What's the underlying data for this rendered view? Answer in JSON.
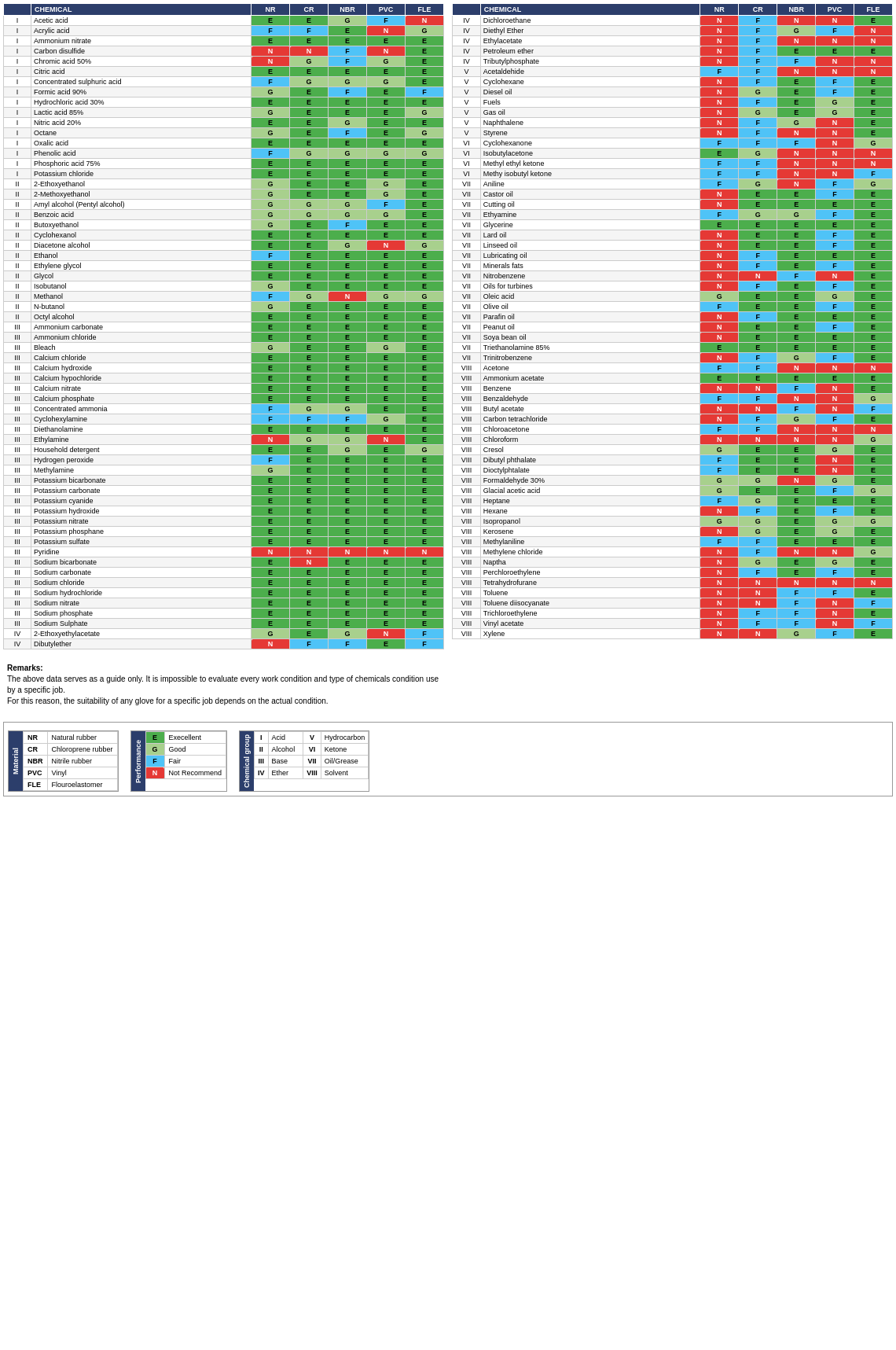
{
  "tables": {
    "left": {
      "headers": [
        "",
        "CHEMICAL",
        "NR",
        "CR",
        "NBR",
        "PVC",
        "FLE"
      ],
      "rows": [
        [
          "I",
          "Acetic acid",
          "E",
          "E",
          "G",
          "F",
          "N"
        ],
        [
          "I",
          "Acrylic acid",
          "F",
          "F",
          "E",
          "N",
          "G"
        ],
        [
          "I",
          "Ammonium nitrate",
          "E",
          "E",
          "E",
          "E",
          "E"
        ],
        [
          "I",
          "Carbon disulfide",
          "N",
          "N",
          "F",
          "N",
          "E"
        ],
        [
          "I",
          "Chromic acid 50%",
          "N",
          "G",
          "F",
          "G",
          "E"
        ],
        [
          "I",
          "Citric acid",
          "E",
          "E",
          "E",
          "E",
          "E"
        ],
        [
          "I",
          "Concentrated sulphuric acid",
          "F",
          "G",
          "G",
          "G",
          "E"
        ],
        [
          "I",
          "Formic acid 90%",
          "G",
          "E",
          "F",
          "E",
          "F"
        ],
        [
          "I",
          "Hydrochloric acid 30%",
          "E",
          "E",
          "E",
          "E",
          "E"
        ],
        [
          "I",
          "Lactic acid 85%",
          "G",
          "E",
          "E",
          "E",
          "G"
        ],
        [
          "I",
          "Nitric acid 20%",
          "E",
          "E",
          "G",
          "E",
          "E"
        ],
        [
          "I",
          "Octane",
          "G",
          "E",
          "F",
          "E",
          "G"
        ],
        [
          "I",
          "Oxalic acid",
          "E",
          "E",
          "E",
          "E",
          "E"
        ],
        [
          "I",
          "Phenolic acid",
          "F",
          "G",
          "G",
          "G",
          "G"
        ],
        [
          "I",
          "Phosphoric acid 75%",
          "E",
          "E",
          "E",
          "E",
          "E"
        ],
        [
          "I",
          "Potassium chloride",
          "E",
          "E",
          "E",
          "E",
          "E"
        ],
        [
          "II",
          "2-Ethoxyethanol",
          "G",
          "E",
          "E",
          "G",
          "E"
        ],
        [
          "II",
          "2-Methoxyethanol",
          "G",
          "E",
          "E",
          "G",
          "E"
        ],
        [
          "II",
          "Amyl alcohol (Pentyl alcohol)",
          "G",
          "G",
          "G",
          "F",
          "E"
        ],
        [
          "II",
          "Benzoic acid",
          "G",
          "G",
          "G",
          "G",
          "E"
        ],
        [
          "II",
          "Butoxyethanol",
          "G",
          "E",
          "F",
          "E",
          "E"
        ],
        [
          "II",
          "Cyclohexanol",
          "E",
          "E",
          "E",
          "E",
          "E"
        ],
        [
          "II",
          "Diacetone alcohol",
          "E",
          "E",
          "G",
          "N",
          "G"
        ],
        [
          "II",
          "Ethanol",
          "F",
          "E",
          "E",
          "E",
          "E"
        ],
        [
          "II",
          "Ethylene glycol",
          "E",
          "E",
          "E",
          "E",
          "E"
        ],
        [
          "II",
          "Glycol",
          "E",
          "E",
          "E",
          "E",
          "E"
        ],
        [
          "II",
          "Isobutanol",
          "G",
          "E",
          "E",
          "E",
          "E"
        ],
        [
          "II",
          "Methanol",
          "F",
          "G",
          "N",
          "G",
          "G"
        ],
        [
          "II",
          "N-butanol",
          "G",
          "E",
          "E",
          "E",
          "E"
        ],
        [
          "II",
          "Octyl alcohol",
          "E",
          "E",
          "E",
          "E",
          "E"
        ],
        [
          "III",
          "Ammonium carbonate",
          "E",
          "E",
          "E",
          "E",
          "E"
        ],
        [
          "III",
          "Ammonium chloride",
          "E",
          "E",
          "E",
          "E",
          "E"
        ],
        [
          "III",
          "Bleach",
          "G",
          "E",
          "E",
          "G",
          "E"
        ],
        [
          "III",
          "Calcium chloride",
          "E",
          "E",
          "E",
          "E",
          "E"
        ],
        [
          "III",
          "Calcium hydroxide",
          "E",
          "E",
          "E",
          "E",
          "E"
        ],
        [
          "III",
          "Calcium hypochloride",
          "E",
          "E",
          "E",
          "E",
          "E"
        ],
        [
          "III",
          "Calcium nitrate",
          "E",
          "E",
          "E",
          "E",
          "E"
        ],
        [
          "III",
          "Calcium phosphate",
          "E",
          "E",
          "E",
          "E",
          "E"
        ],
        [
          "III",
          "Concentrated ammonia",
          "F",
          "G",
          "G",
          "E",
          "E"
        ],
        [
          "III",
          "Cyclohexylamine",
          "F",
          "F",
          "F",
          "G",
          "E"
        ],
        [
          "III",
          "Diethanolamine",
          "E",
          "E",
          "E",
          "E",
          "E"
        ],
        [
          "III",
          "Ethylamine",
          "N",
          "G",
          "G",
          "N",
          "E"
        ],
        [
          "III",
          "Household detergent",
          "E",
          "E",
          "G",
          "E",
          "G"
        ],
        [
          "III",
          "Hydrogen peroxide",
          "F",
          "E",
          "E",
          "E",
          "E"
        ],
        [
          "III",
          "Methylamine",
          "G",
          "E",
          "E",
          "E",
          "E"
        ],
        [
          "III",
          "Potassium bicarbonate",
          "E",
          "E",
          "E",
          "E",
          "E"
        ],
        [
          "III",
          "Potassium carbonate",
          "E",
          "E",
          "E",
          "E",
          "E"
        ],
        [
          "III",
          "Potassium cyanide",
          "E",
          "E",
          "E",
          "E",
          "E"
        ],
        [
          "III",
          "Potassium hydroxide",
          "E",
          "E",
          "E",
          "E",
          "E"
        ],
        [
          "III",
          "Potassium nitrate",
          "E",
          "E",
          "E",
          "E",
          "E"
        ],
        [
          "III",
          "Potassium phosphane",
          "E",
          "E",
          "E",
          "E",
          "E"
        ],
        [
          "III",
          "Potassium sulfate",
          "E",
          "E",
          "E",
          "E",
          "E"
        ],
        [
          "III",
          "Pyridine",
          "N",
          "N",
          "N",
          "N",
          "N"
        ],
        [
          "III",
          "Sodium bicarbonate",
          "E",
          "N",
          "E",
          "E",
          "E"
        ],
        [
          "III",
          "Sodium carbonate",
          "E",
          "E",
          "E",
          "E",
          "E"
        ],
        [
          "III",
          "Sodium chloride",
          "E",
          "E",
          "E",
          "E",
          "E"
        ],
        [
          "III",
          "Sodium hydrochloride",
          "E",
          "E",
          "E",
          "E",
          "E"
        ],
        [
          "III",
          "Sodium nitrate",
          "E",
          "E",
          "E",
          "E",
          "E"
        ],
        [
          "III",
          "Sodium phosphate",
          "E",
          "E",
          "E",
          "E",
          "E"
        ],
        [
          "III",
          "Sodium Sulphate",
          "E",
          "E",
          "E",
          "E",
          "E"
        ],
        [
          "IV",
          "2-Ethoxyethylacetate",
          "G",
          "E",
          "G",
          "N",
          "F"
        ],
        [
          "IV",
          "Dibutylether",
          "N",
          "F",
          "F",
          "E",
          "F"
        ]
      ]
    },
    "right": {
      "headers": [
        "",
        "CHEMICAL",
        "NR",
        "CR",
        "NBR",
        "PVC",
        "FLE"
      ],
      "rows": [
        [
          "IV",
          "Dichloroethane",
          "N",
          "F",
          "N",
          "N",
          "E"
        ],
        [
          "IV",
          "Diethyl Ether",
          "N",
          "F",
          "G",
          "F",
          "N"
        ],
        [
          "IV",
          "Ethylacetate",
          "N",
          "F",
          "N",
          "N",
          "N"
        ],
        [
          "IV",
          "Petroleum ether",
          "N",
          "F",
          "E",
          "E",
          "E"
        ],
        [
          "IV",
          "Tributylphosphate",
          "N",
          "F",
          "F",
          "N",
          "N"
        ],
        [
          "V",
          "Acetaldehide",
          "F",
          "F",
          "N",
          "N",
          "N"
        ],
        [
          "V",
          "Cyclohexane",
          "N",
          "F",
          "E",
          "F",
          "E"
        ],
        [
          "V",
          "Diesel oil",
          "N",
          "G",
          "E",
          "F",
          "E"
        ],
        [
          "V",
          "Fuels",
          "N",
          "F",
          "E",
          "G",
          "E"
        ],
        [
          "V",
          "Gas oil",
          "N",
          "G",
          "E",
          "G",
          "E"
        ],
        [
          "V",
          "Naphthalene",
          "N",
          "F",
          "G",
          "N",
          "E"
        ],
        [
          "V",
          "Styrene",
          "N",
          "F",
          "N",
          "N",
          "E"
        ],
        [
          "VI",
          "Cyclohexanone",
          "F",
          "F",
          "F",
          "N",
          "G"
        ],
        [
          "VI",
          "Isobutylacetone",
          "E",
          "G",
          "N",
          "N",
          "N"
        ],
        [
          "VI",
          "Methyl ethyl ketone",
          "F",
          "F",
          "N",
          "N",
          "N"
        ],
        [
          "VI",
          "Methy isobutyl ketone",
          "F",
          "F",
          "N",
          "N",
          "F"
        ],
        [
          "VII",
          "Aniline",
          "F",
          "G",
          "N",
          "F",
          "G"
        ],
        [
          "VII",
          "Castor oil",
          "N",
          "E",
          "E",
          "F",
          "E"
        ],
        [
          "VII",
          "Cutting oil",
          "N",
          "E",
          "E",
          "E",
          "E"
        ],
        [
          "VII",
          "Ethyamine",
          "F",
          "G",
          "G",
          "F",
          "E"
        ],
        [
          "VII",
          "Glycerine",
          "E",
          "E",
          "E",
          "E",
          "E"
        ],
        [
          "VII",
          "Lard oil",
          "N",
          "E",
          "E",
          "F",
          "E"
        ],
        [
          "VII",
          "Linseed oil",
          "N",
          "E",
          "E",
          "F",
          "E"
        ],
        [
          "VII",
          "Lubricating oil",
          "N",
          "F",
          "E",
          "E",
          "E"
        ],
        [
          "VII",
          "Minerals fats",
          "N",
          "F",
          "E",
          "F",
          "E"
        ],
        [
          "VII",
          "Nitrobenzene",
          "N",
          "N",
          "F",
          "N",
          "E"
        ],
        [
          "VII",
          "Oils for turbines",
          "N",
          "F",
          "E",
          "F",
          "E"
        ],
        [
          "VII",
          "Oleic acid",
          "G",
          "E",
          "E",
          "G",
          "E"
        ],
        [
          "VII",
          "Olive oil",
          "F",
          "E",
          "E",
          "F",
          "E"
        ],
        [
          "VII",
          "Parafin oil",
          "N",
          "F",
          "E",
          "E",
          "E"
        ],
        [
          "VII",
          "Peanut oil",
          "N",
          "E",
          "E",
          "F",
          "E"
        ],
        [
          "VII",
          "Soya bean oil",
          "N",
          "E",
          "E",
          "E",
          "E"
        ],
        [
          "VII",
          "Triethanolamine 85%",
          "E",
          "E",
          "E",
          "E",
          "E"
        ],
        [
          "VII",
          "Trinitrobenzene",
          "N",
          "F",
          "G",
          "F",
          "E"
        ],
        [
          "VIII",
          "Acetone",
          "F",
          "F",
          "N",
          "N",
          "N"
        ],
        [
          "VIII",
          "Ammonium acetate",
          "E",
          "E",
          "E",
          "E",
          "E"
        ],
        [
          "VIII",
          "Benzene",
          "N",
          "N",
          "F",
          "N",
          "E"
        ],
        [
          "VIII",
          "Benzaldehyde",
          "F",
          "F",
          "N",
          "N",
          "G"
        ],
        [
          "VIII",
          "Butyl acetate",
          "N",
          "N",
          "F",
          "N",
          "F"
        ],
        [
          "VIII",
          "Carbon tetrachloride",
          "N",
          "F",
          "G",
          "F",
          "E"
        ],
        [
          "VIII",
          "Chloroacetone",
          "F",
          "F",
          "N",
          "N",
          "N"
        ],
        [
          "VIII",
          "Chloroform",
          "N",
          "N",
          "N",
          "N",
          "G"
        ],
        [
          "VIII",
          "Cresol",
          "G",
          "E",
          "E",
          "G",
          "E"
        ],
        [
          "VIII",
          "Dibutyl phthalate",
          "F",
          "E",
          "E",
          "N",
          "E"
        ],
        [
          "VIII",
          "Dioctylphtalate",
          "F",
          "E",
          "E",
          "N",
          "E"
        ],
        [
          "VIII",
          "Formaldehyde 30%",
          "G",
          "G",
          "N",
          "G",
          "E"
        ],
        [
          "VIII",
          "Glacial acetic acid",
          "G",
          "E",
          "E",
          "F",
          "G"
        ],
        [
          "VIII",
          "Heptane",
          "F",
          "G",
          "E",
          "E",
          "E"
        ],
        [
          "VIII",
          "Hexane",
          "N",
          "F",
          "E",
          "F",
          "E"
        ],
        [
          "VIII",
          "Isopropanol",
          "G",
          "G",
          "E",
          "G",
          "G"
        ],
        [
          "VIII",
          "Kerosene",
          "N",
          "G",
          "E",
          "G",
          "E"
        ],
        [
          "VIII",
          "Methylaniline",
          "F",
          "F",
          "E",
          "E",
          "E"
        ],
        [
          "VIII",
          "Methylene chloride",
          "N",
          "F",
          "N",
          "N",
          "G"
        ],
        [
          "VIII",
          "Naptha",
          "N",
          "G",
          "E",
          "G",
          "E"
        ],
        [
          "VIII",
          "Perchloroethylene",
          "N",
          "F",
          "E",
          "F",
          "E"
        ],
        [
          "VIII",
          "Tetrahydrofurane",
          "N",
          "N",
          "N",
          "N",
          "N"
        ],
        [
          "VIII",
          "Toluene",
          "N",
          "N",
          "F",
          "F",
          "E"
        ],
        [
          "VIII",
          "Toluene diisocyanate",
          "N",
          "N",
          "F",
          "N",
          "F"
        ],
        [
          "VIII",
          "Trichloroethylene",
          "N",
          "F",
          "F",
          "N",
          "E"
        ],
        [
          "VIII",
          "Vinyl acetate",
          "N",
          "F",
          "F",
          "N",
          "F"
        ],
        [
          "VIII",
          "Xylene",
          "N",
          "N",
          "G",
          "F",
          "E"
        ]
      ]
    }
  },
  "remarks": {
    "title": "Remarks:",
    "line1": "The above data serves as a guide only. It is impossible to evaluate every work condition and type of chemicals condition use",
    "line2": "by a specific job.",
    "line3": "For this reason, the suitability of any glove for a specific job depends on the actual condition."
  },
  "legend": {
    "material": {
      "title": "Material",
      "rows": [
        [
          "NR",
          "Natural rubber"
        ],
        [
          "CR",
          "Chloroprene rubber"
        ],
        [
          "NBR",
          "Nitrile rubber"
        ],
        [
          "PVC",
          "Vinyl"
        ],
        [
          "FLE",
          "Flouroelastomer"
        ]
      ]
    },
    "performance": {
      "title": "Performance",
      "rows": [
        [
          "E",
          "Execellent"
        ],
        [
          "G",
          "Good"
        ],
        [
          "F",
          "Fair"
        ],
        [
          "N",
          "Not Recommend"
        ]
      ]
    },
    "chemical_group": {
      "title": "Chemical group",
      "rows": [
        [
          "I",
          "Acid",
          "V",
          "Hydrocarbon"
        ],
        [
          "II",
          "Alcohol",
          "VI",
          "Ketone"
        ],
        [
          "III",
          "Base",
          "VII",
          "Oil/Grease"
        ],
        [
          "IV",
          "Ether",
          "VIII",
          "Solvent"
        ]
      ]
    }
  }
}
